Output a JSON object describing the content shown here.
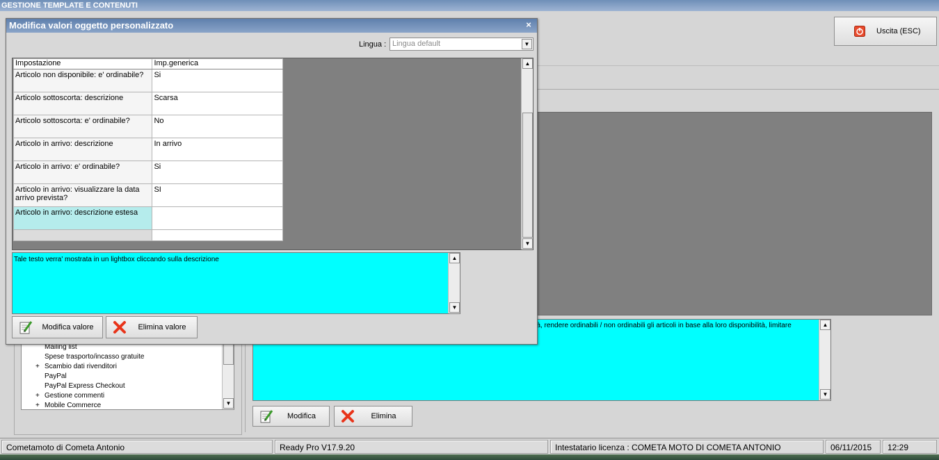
{
  "app": {
    "title": "GESTIONE TEMPLATE E CONTENUTI"
  },
  "exit_button": {
    "label": "Uscita (ESC)",
    "icon": "power-icon"
  },
  "tree": {
    "items": [
      {
        "label": "Mailing list",
        "expandable": false
      },
      {
        "label": "Spese trasporto/incasso gratuite",
        "expandable": false
      },
      {
        "label": "Scambio dati rivenditori",
        "expandable": true
      },
      {
        "label": "PayPal",
        "expandable": false
      },
      {
        "label": "PayPal Express Checkout",
        "expandable": false
      },
      {
        "label": "Gestione commenti",
        "expandable": true
      },
      {
        "label": "Mobile Commerce",
        "expandable": true
      }
    ]
  },
  "main": {
    "description": "ilità, rendere ordinabili / non ordinabili gli articoli in base alla loro disponibilità, limitare",
    "modify_label": "Modifica",
    "delete_label": "Elimina"
  },
  "dialog": {
    "title": "Modifica valori oggetto personalizzato",
    "close_glyph": "×",
    "language_label": "Lingua :",
    "language_value": "Lingua default",
    "columns": [
      "Impostazione",
      "Imp.generica"
    ],
    "rows": [
      {
        "key": "Articolo non disponibile: e' ordinabile?",
        "value": "Si"
      },
      {
        "key": "Articolo sottoscorta: descrizione",
        "value": "Scarsa"
      },
      {
        "key": "Articolo sottoscorta: e' ordinabile?",
        "value": "No"
      },
      {
        "key": "Articolo in arrivo: descrizione",
        "value": "In arrivo"
      },
      {
        "key": "Articolo in arrivo: e' ordinabile?",
        "value": "Si"
      },
      {
        "key": "Articolo in arrivo: visualizzare la data arrivo prevista?",
        "value": "SI"
      },
      {
        "key": "Articolo in arrivo: descrizione estesa",
        "value": ""
      }
    ],
    "selected_row": 6,
    "description": "Tale testo verra' mostrata in un lightbox cliccando sulla descrizione",
    "modify_value_label": "Modifica valore",
    "delete_value_label": "Elimina valore"
  },
  "status": {
    "company": "Cometamoto di Cometa Antonio",
    "version": "Ready Pro V17.9.20",
    "license": "Intestatario licenza : COMETA MOTO DI COMETA ANTONIO",
    "date": "06/11/2015",
    "time": "12:29"
  },
  "colors": {
    "accent_cyan": "#00ffff",
    "title_blue": "#6f8fb8",
    "grid_gray": "#808080"
  }
}
